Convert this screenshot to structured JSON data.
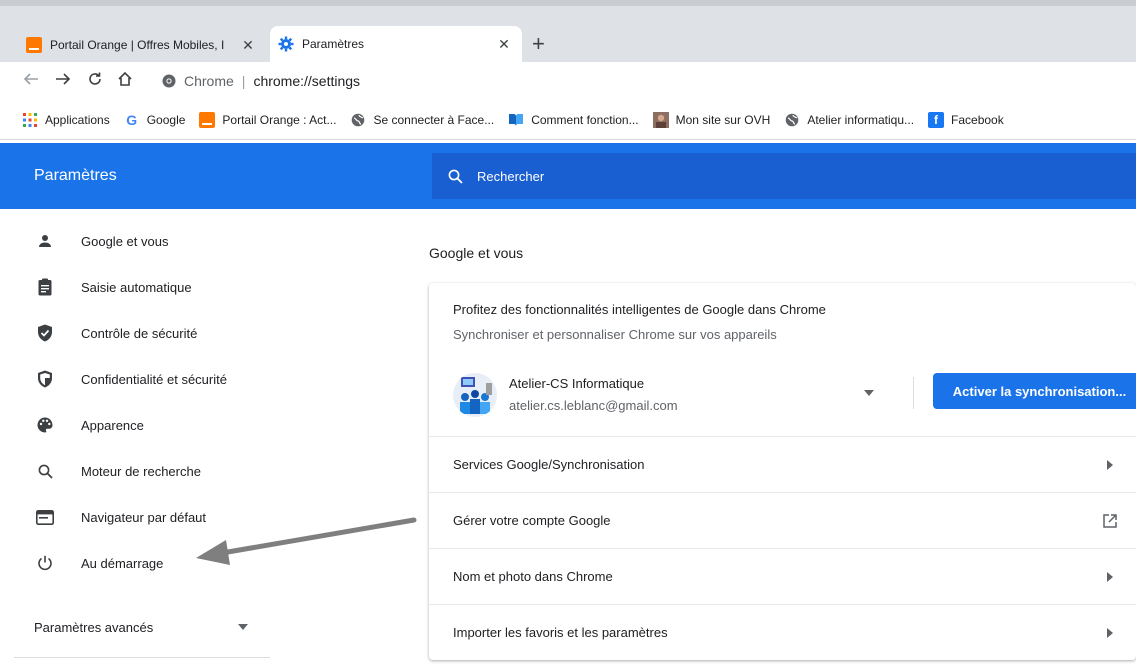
{
  "browser": {
    "tabs": [
      {
        "title": "Portail Orange | Offres Mobiles, I",
        "close": "✕",
        "favicon": "orange-icon"
      },
      {
        "title": "Paramètres",
        "close": "✕",
        "favicon": "gear-icon"
      }
    ],
    "new_tab": "+",
    "site_label": "Chrome",
    "separator": "|",
    "url": "chrome://settings",
    "bookmarks": [
      {
        "label": "Applications",
        "icon": "apps-grid-icon"
      },
      {
        "label": "Google",
        "icon": "google-icon"
      },
      {
        "label": "Portail Orange : Act...",
        "icon": "orange-icon"
      },
      {
        "label": "Se connecter à Face...",
        "icon": "globe-icon"
      },
      {
        "label": "Comment fonction...",
        "icon": "book-icon"
      },
      {
        "label": "Mon site sur OVH",
        "icon": "photo-icon"
      },
      {
        "label": "Atelier informatiqu...",
        "icon": "globe-icon"
      },
      {
        "label": "Facebook",
        "icon": "facebook-icon"
      }
    ]
  },
  "settings": {
    "title": "Paramètres",
    "search_placeholder": "Rechercher",
    "sidebar": [
      {
        "label": "Google et vous",
        "icon": "person-icon"
      },
      {
        "label": "Saisie automatique",
        "icon": "clipboard-icon"
      },
      {
        "label": "Contrôle de sécurité",
        "icon": "shield-check-icon"
      },
      {
        "label": "Confidentialité et sécurité",
        "icon": "shield-half-icon"
      },
      {
        "label": "Apparence",
        "icon": "palette-icon"
      },
      {
        "label": "Moteur de recherche",
        "icon": "search-icon"
      },
      {
        "label": "Navigateur par défaut",
        "icon": "browser-window-icon"
      },
      {
        "label": "Au démarrage",
        "icon": "power-icon"
      }
    ],
    "advanced_label": "Paramètres avancés",
    "section_title": "Google et vous",
    "promo_title": "Profitez des fonctionnalités intelligentes de Google dans Chrome",
    "promo_subtitle": "Synchroniser et personnaliser Chrome sur vos appareils",
    "account": {
      "name": "Atelier-CS Informatique",
      "email": "atelier.cs.leblanc@gmail.com"
    },
    "sync_button": "Activer la synchronisation...",
    "rows": [
      {
        "label": "Services Google/Synchronisation",
        "icon": "chevron-right-icon"
      },
      {
        "label": "Gérer votre compte Google",
        "icon": "external-link-icon"
      },
      {
        "label": "Nom et photo dans Chrome",
        "icon": "chevron-right-icon"
      },
      {
        "label": "Importer les favoris et les paramètres",
        "icon": "chevron-right-icon"
      }
    ]
  },
  "colors": {
    "accent": "#1a73e8",
    "header_search": "#1a5fd1",
    "annotation_arrow": "#7f7f7f"
  }
}
